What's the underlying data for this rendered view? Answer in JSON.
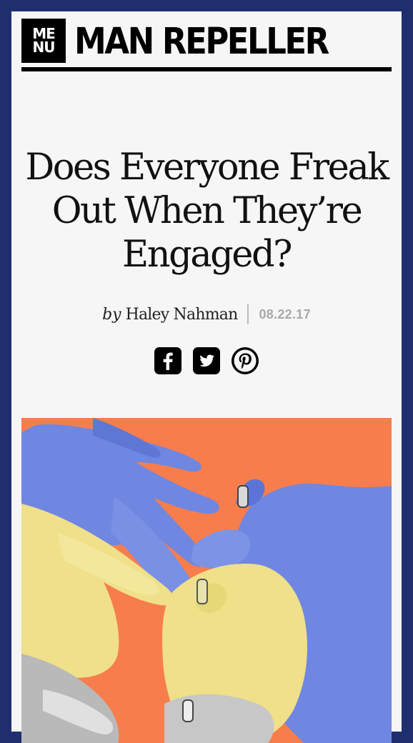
{
  "header": {
    "menu_line1": "ME",
    "menu_line2": "NU",
    "site_name": "MAN REPELLER"
  },
  "article": {
    "title": "Does Everyone Freak Out When They’re Engaged?",
    "byline_prefix": "by",
    "author": "Haley Nahman",
    "date": "08.22.17"
  },
  "share_icons": [
    "facebook-icon",
    "twitter-icon",
    "pinterest-icon"
  ],
  "hero_image": {
    "description_colors": {
      "background": "#f87d4d",
      "blue": "#6f87e0",
      "yellow": "#efe089",
      "gray": "#b9b9b9"
    }
  }
}
